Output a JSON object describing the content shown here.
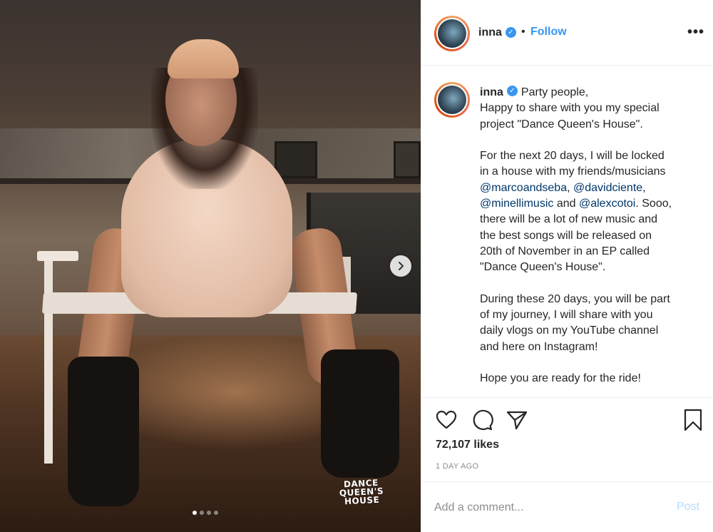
{
  "post": {
    "username": "inna",
    "separator": "•",
    "follow_label": "Follow",
    "more_label": "•••",
    "caption": {
      "first_line": "Party people,",
      "lines_a": "Happy to share with you my special\nproject \"Dance Queen's House\".\n\nFor the next 20 days, I will be locked\nin a house with my friends/musicians\n",
      "mention1": "@marcoandseba",
      "sep1": ", ",
      "mention2": "@davidciente",
      "sep2": ",\n",
      "mention3": "@minellimusic",
      "sep3": " and ",
      "mention4": "@alexcotoi",
      "lines_b": ". Sooo,\nthere will be a lot of new music and\nthe best songs will be released on\n20th of November in an EP called\n\"Dance Queen's House\".\n\nDuring these 20 days, you will be part\nof my journey, I will share with you\ndaily vlogs on my YouTube channel\nand here on Instagram!\n\nHope you are ready for the ride!"
    },
    "likes": "72,107 likes",
    "time_ago": "1 DAY AGO",
    "comment_placeholder": "Add a comment...",
    "post_label": "Post",
    "image_overlay_logo": [
      "DANCE",
      "QUEEN'S",
      "HOUSE"
    ],
    "carousel": {
      "count": 4,
      "active_index": 0
    },
    "colors": {
      "link": "#3897f0",
      "mention": "#00376b",
      "muted": "#8e8e8e",
      "post_disabled": "#b3dbff"
    }
  }
}
